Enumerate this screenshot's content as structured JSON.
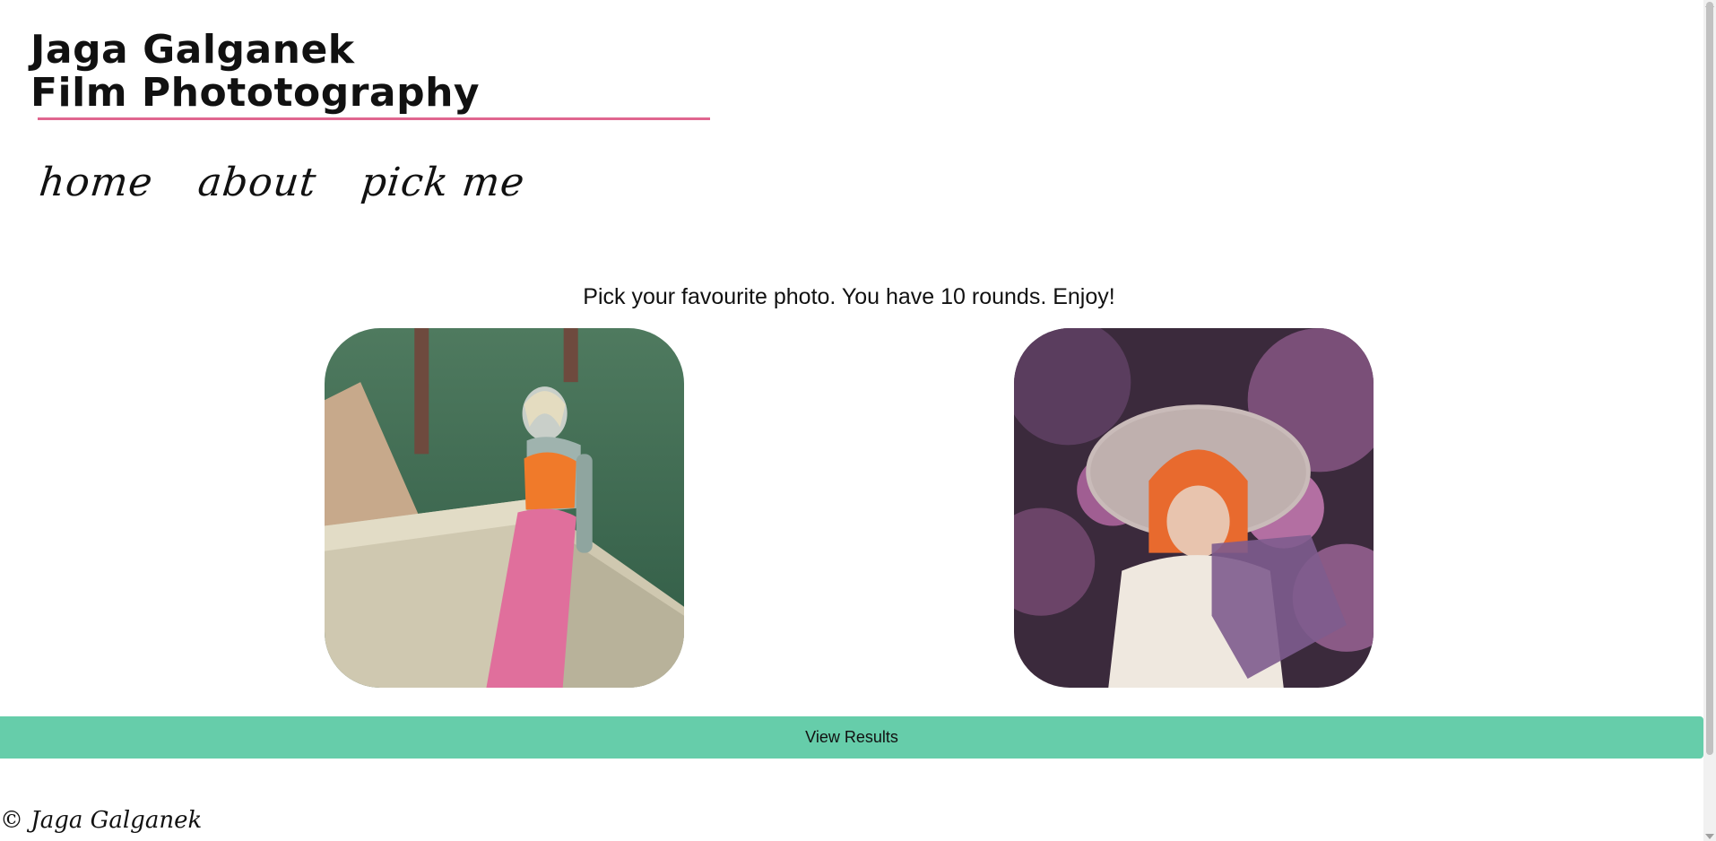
{
  "header": {
    "title_line1": "Jaga Galganek",
    "title_line2": "Film Phototography",
    "accent_color": "#e0668f"
  },
  "nav": {
    "items": [
      {
        "label": "home"
      },
      {
        "label": "about"
      },
      {
        "label": "pick me"
      }
    ]
  },
  "main": {
    "instructions": "Pick your favourite photo. You have 10 rounds. Enjoy!",
    "photos": [
      {
        "subject": "woman in orange top and pink trousers leaning on concrete wall, green grass background"
      },
      {
        "subject": "woman with orange hair in large white hat among purple foliage"
      }
    ],
    "results_button_label": "View Results",
    "button_color": "#66cdaa"
  },
  "footer": {
    "copyright": "© Jaga Galganek"
  }
}
